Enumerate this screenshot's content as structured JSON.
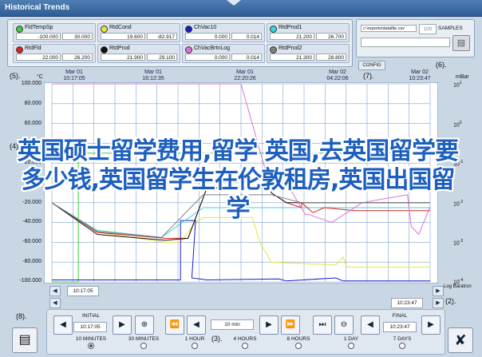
{
  "window": {
    "title": "Historical Trends"
  },
  "channels": [
    {
      "name": "FldTempSp",
      "color": "#3ccd3c",
      "min": "-100.000",
      "max": "30.000"
    },
    {
      "name": "RtdCond",
      "color": "#e5e53a",
      "min": "19.600",
      "max": "-82.917"
    },
    {
      "name": "ChVac10",
      "color": "#1c1cc4",
      "min": "0.000",
      "max": "0.014"
    },
    {
      "name": "RtdProd1",
      "color": "#3ad6dc",
      "min": "21.200",
      "max": "26.700"
    },
    {
      "name": "RtdFld",
      "color": "#e02020",
      "min": "22.000",
      "max": "26.200"
    },
    {
      "name": "RtdProd",
      "color": "#111111",
      "min": "21.900",
      "max": "29.100"
    },
    {
      "name": "ChVacBrtnLog",
      "color": "#e070d8",
      "min": "0.000",
      "max": "0.014"
    },
    {
      "name": "RtdProd2",
      "color": "#808080",
      "min": "21.300",
      "max": "28.800"
    }
  ],
  "samples": {
    "path": "c:\\reports\\datafile.csv",
    "value": "100",
    "label": "SAMPLES",
    "disk_icon": "floppy-disk-icon"
  },
  "config_label": "CONFIG",
  "callouts": {
    "c5": "(5).",
    "c7": "(7).",
    "c6": "(6).",
    "c4": "(4).",
    "c8": "(8).",
    "c2": "(2).",
    "c3": "(3)."
  },
  "time_labels": [
    {
      "date": "Mar 01",
      "time": "10:17:05"
    },
    {
      "date": "Mar 01",
      "time": "16:12:35"
    },
    {
      "date": "Mar 01",
      "time": "22:20:26"
    },
    {
      "date": "Mar 02",
      "time": "04:22:06"
    },
    {
      "date": "Mar 02",
      "time": "10:23:47"
    }
  ],
  "left_unit": "°C",
  "right_unit": "mBar",
  "y_left": [
    "100.000",
    "80.000",
    "60.000",
    "40.000",
    "20.000",
    "0.000",
    "-20.000",
    "-40.000",
    "-60.000",
    "-80.000",
    "-100.000"
  ],
  "y_right": [
    {
      "base": "10",
      "exp": "1"
    },
    {
      "base": "10",
      "exp": "0"
    },
    {
      "base": "10",
      "exp": "-1"
    },
    {
      "base": "10",
      "exp": "-2"
    },
    {
      "base": "10",
      "exp": "-3"
    },
    {
      "base": "10",
      "exp": "-4"
    }
  ],
  "watermark": "英国硕士留学费用,留学 英国,去英国留学要多少钱,英国留学生在伦敦租房,英国出国留学",
  "scroll": {
    "start": "10:17:05",
    "end": "10:23:47",
    "log_label": "Log Baratron"
  },
  "controls": {
    "initial_label": "INITIAL",
    "initial_time": "10:17:05",
    "interval": "10 min",
    "final_label": "FINAL",
    "final_time": "10:23:47",
    "ranges": [
      "10 MINUTES",
      "30 MINUTES",
      "1 HOUR",
      "4 HOURS",
      "8 HOURS",
      "1 DAY",
      "7 DAYS"
    ],
    "selected_range": "10 MINUTES"
  },
  "chart_data": {
    "type": "line",
    "title": "",
    "x": [
      "Mar 01 10:17:05",
      "Mar 01 16:12:35",
      "Mar 01 22:20:26",
      "Mar 02 04:22:06",
      "Mar 02 10:23:47"
    ],
    "ylim_left": [
      -100,
      100
    ],
    "ylim_right_log10": [
      -4,
      1
    ],
    "grid": true,
    "series": [
      {
        "name": "FldTempSp",
        "axis": "left",
        "points": [
          [
            0.0,
            -100
          ],
          [
            0.07,
            -100
          ],
          [
            0.07,
            30
          ],
          [
            0.34,
            30
          ],
          [
            0.41,
            30
          ],
          [
            1.0,
            30
          ]
        ]
      },
      {
        "name": "RtdCond",
        "axis": "left",
        "points": [
          [
            0.0,
            -20
          ],
          [
            0.12,
            -50
          ],
          [
            0.3,
            -60
          ],
          [
            0.34,
            -60
          ],
          [
            0.38,
            -40
          ],
          [
            0.4,
            -35
          ],
          [
            0.53,
            -35
          ],
          [
            0.55,
            -60
          ],
          [
            0.58,
            -80
          ],
          [
            0.7,
            -82
          ],
          [
            0.75,
            -83
          ],
          [
            0.77,
            -75
          ],
          [
            0.78,
            -85
          ],
          [
            1.0,
            -85
          ]
        ]
      },
      {
        "name": "ChVac10",
        "axis": "left",
        "points": [
          [
            0.0,
            -98
          ],
          [
            0.34,
            -98
          ],
          [
            0.34,
            -38
          ],
          [
            0.38,
            -38
          ],
          [
            0.37,
            -96
          ],
          [
            0.41,
            -98
          ],
          [
            0.6,
            -97
          ],
          [
            0.62,
            -99
          ],
          [
            0.75,
            -96
          ],
          [
            0.77,
            -99
          ],
          [
            1.0,
            -99
          ]
        ]
      },
      {
        "name": "RtdProd1",
        "axis": "left",
        "points": [
          [
            0.0,
            -20
          ],
          [
            0.12,
            -48
          ],
          [
            0.29,
            -55
          ],
          [
            0.4,
            -25
          ],
          [
            0.58,
            -25
          ],
          [
            0.62,
            -25
          ],
          [
            1.0,
            -25
          ]
        ]
      },
      {
        "name": "RtdFld",
        "axis": "left",
        "points": [
          [
            0.0,
            -20
          ],
          [
            0.12,
            -50
          ],
          [
            0.3,
            -56
          ],
          [
            0.36,
            -56
          ],
          [
            0.41,
            -5
          ],
          [
            0.58,
            -5
          ],
          [
            0.58,
            -10
          ],
          [
            0.62,
            -20
          ],
          [
            0.66,
            -25
          ],
          [
            0.66,
            -20
          ],
          [
            0.69,
            -30
          ],
          [
            0.72,
            -25
          ],
          [
            0.8,
            -28
          ],
          [
            1.0,
            -28
          ]
        ]
      },
      {
        "name": "RtdProd",
        "axis": "left",
        "points": [
          [
            0.0,
            -20
          ],
          [
            0.12,
            -52
          ],
          [
            0.3,
            -58
          ],
          [
            0.36,
            -56
          ],
          [
            0.41,
            -5
          ],
          [
            0.58,
            -5
          ],
          [
            0.58,
            -10
          ],
          [
            0.62,
            -20
          ],
          [
            1.0,
            -20
          ]
        ]
      },
      {
        "name": "ChVacBrtnLog",
        "axis": "right",
        "points": [
          [
            0.0,
            1
          ],
          [
            0.5,
            1
          ],
          [
            0.58,
            -1.7
          ],
          [
            0.62,
            -1.5
          ],
          [
            0.67,
            -2.3
          ],
          [
            0.68,
            -2.3
          ],
          [
            0.74,
            -2.5
          ],
          [
            0.82,
            -2.0
          ],
          [
            0.88,
            -1.9
          ],
          [
            0.94,
            -1.8
          ],
          [
            0.95,
            -2.6
          ],
          [
            0.97,
            -2.8
          ],
          [
            1.0,
            -2.1
          ]
        ]
      },
      {
        "name": "RtdProd2",
        "axis": "left",
        "points": [
          [
            0.0,
            -20
          ],
          [
            0.12,
            -49
          ],
          [
            0.29,
            -55
          ],
          [
            0.4,
            -12
          ],
          [
            0.58,
            -12
          ],
          [
            0.66,
            -20
          ],
          [
            1.0,
            -20
          ]
        ]
      }
    ]
  }
}
